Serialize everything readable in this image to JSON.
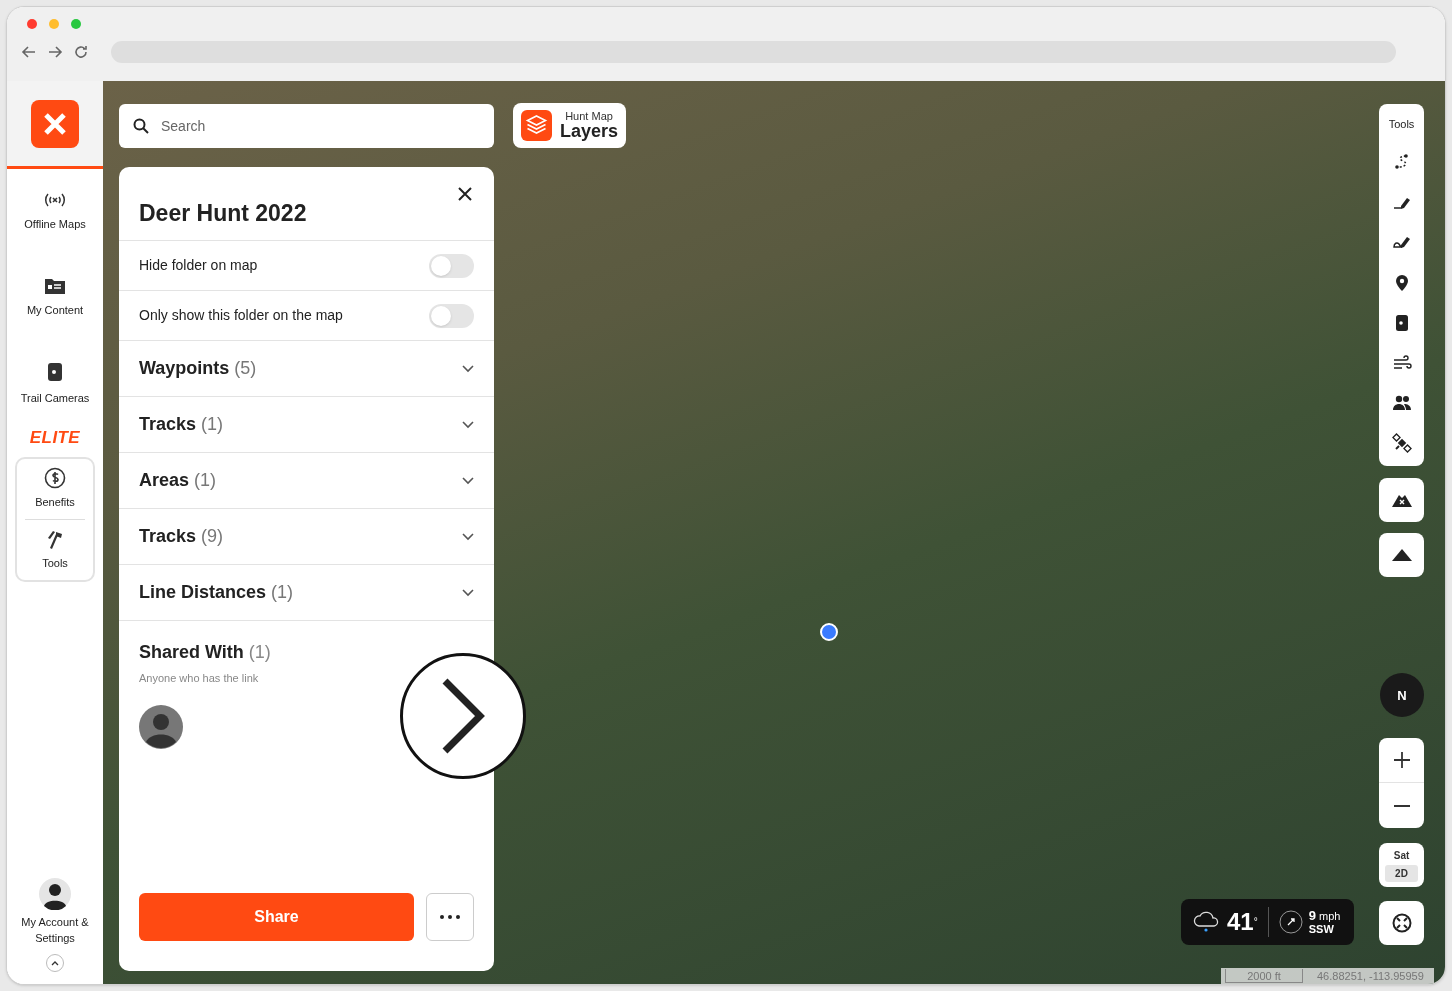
{
  "sidebar": {
    "items": [
      {
        "kind": "nav",
        "label": "Offline Maps"
      },
      {
        "kind": "nav",
        "label": "My Content"
      },
      {
        "kind": "nav",
        "label": "Trail Cameras"
      }
    ],
    "badge": "ELITE",
    "elite_items": [
      {
        "label": "Benefits"
      },
      {
        "label": "Tools"
      }
    ],
    "account": {
      "label": "My Account & Settings"
    }
  },
  "search": {
    "placeholder": "Search"
  },
  "layers_button": {
    "caption": "Hunt Map",
    "label": "Layers"
  },
  "panel": {
    "title": "Deer Hunt 2022",
    "toggles": [
      {
        "label": "Hide folder on map",
        "on": false
      },
      {
        "label": "Only show this folder on the map",
        "on": false
      }
    ],
    "sections": [
      {
        "label": "Waypoints",
        "count": "(5)",
        "expanded": false
      },
      {
        "label": "Tracks",
        "count": "(1)",
        "expanded": false
      },
      {
        "label": "Areas",
        "count": "(1)",
        "expanded": false
      },
      {
        "label": "Tracks",
        "count": "(9)",
        "expanded": false
      },
      {
        "label": "Line Distances",
        "count": "(1)",
        "expanded": false
      }
    ],
    "shared_with": {
      "label": "Shared With",
      "count": "(1)",
      "subtitle": "Anyone who has the link"
    },
    "share_button": "Share"
  },
  "tools": {
    "title": "Tools"
  },
  "compass": {
    "label": "N"
  },
  "map_style": {
    "label": "Sat",
    "mode": "2D"
  },
  "weather": {
    "temperature": "41",
    "degree": "°",
    "wind_speed": "9",
    "wind_unit": "mph",
    "wind_direction": "SSW"
  },
  "scale": "2000 ft",
  "coordinates": "46.88251, -113.95959"
}
